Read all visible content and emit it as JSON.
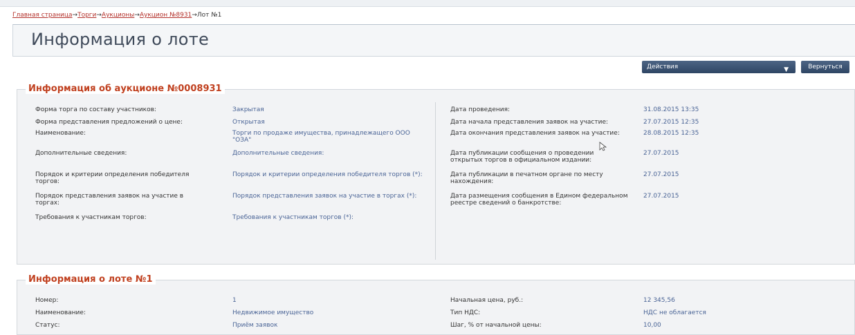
{
  "breadcrumb": {
    "items": [
      "Главная страница",
      "Торги",
      "Аукционы",
      "Аукцион №8931"
    ],
    "current": "Лот №1",
    "separator": "→"
  },
  "page_title": "Информация о лоте",
  "toolbar": {
    "actions_label": "Действия",
    "back_label": "Вернуться"
  },
  "auction": {
    "title": "Информация об аукционе №0008931",
    "left": [
      {
        "label": "Форма торга по составу участников:",
        "value": "Закрытая"
      },
      {
        "label": "Форма представления предложений о цене:",
        "value": "Открытая"
      },
      {
        "label": "Наименование:",
        "value": "Торги по продаже имущества, принадлежащего ООО \"ОЗА\""
      },
      {
        "label": "Дополнительные сведения:",
        "value": "Дополнительные сведения:"
      },
      {
        "label": "Порядок и критерии определения победителя торгов:",
        "value": "Порядок и критерии определения победителя торгов (*):"
      },
      {
        "label": "Порядок представления заявок на участие в торгах:",
        "value": "Порядок представления заявок на участие в торгах (*):"
      },
      {
        "label": "Требования к участникам торгов:",
        "value": "Требования к участникам торгов (*):"
      }
    ],
    "right": [
      {
        "label": "Дата проведения:",
        "value": "31.08.2015 13:35"
      },
      {
        "label": "Дата начала представления заявок на участие:",
        "value": "27.07.2015 12:35"
      },
      {
        "label": "Дата окончания представления заявок на участие:",
        "value": "28.08.2015 12:35"
      },
      {
        "label": "Дата публикации сообщения о проведении открытых торгов в официальном издании:",
        "value": "27.07.2015"
      },
      {
        "label": "Дата публикации в печатном органе по месту нахождения:",
        "value": "27.07.2015"
      },
      {
        "label": "Дата размещения сообщения в Едином федеральном реестре сведений о банкротстве:",
        "value": "27.07.2015"
      }
    ]
  },
  "lot": {
    "title": "Информация о лоте №1",
    "left": [
      {
        "label": "Номер:",
        "value": "1"
      },
      {
        "label": "Наименование:",
        "value": "Недвижимое имущество"
      },
      {
        "label": "Статус:",
        "value": "Приём заявок"
      }
    ],
    "right": [
      {
        "label": "Начальная цена, руб.:",
        "value": "12 345,56"
      },
      {
        "label": "Тип НДС:",
        "value": "НДС не облагается"
      },
      {
        "label": "Шаг, % от начальной цены:",
        "value": "10,00"
      }
    ]
  }
}
